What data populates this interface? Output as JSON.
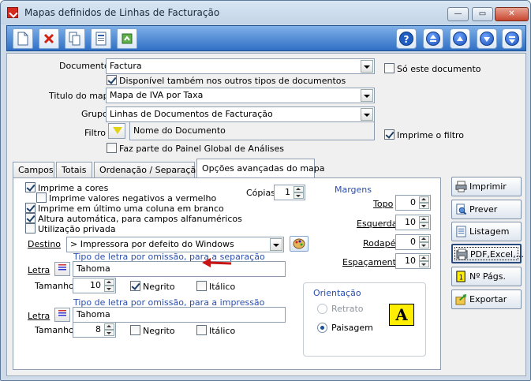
{
  "window": {
    "title": "Mapas definidos de Linhas de Facturação",
    "controls": {
      "minimize": "—",
      "maximize": "▭",
      "close": "✕"
    }
  },
  "toolbar": {
    "buttons": [
      {
        "name": "new",
        "icon": "new-document-icon"
      },
      {
        "name": "delete",
        "icon": "delete-x-icon"
      },
      {
        "name": "copy",
        "icon": "copy-icon"
      },
      {
        "name": "properties",
        "icon": "properties-icon"
      },
      {
        "name": "refresh",
        "icon": "refresh-icon"
      }
    ],
    "nav_buttons": [
      {
        "name": "help",
        "icon": "help-icon",
        "glyph": "?"
      },
      {
        "name": "first",
        "icon": "first-record-icon"
      },
      {
        "name": "previous",
        "icon": "previous-record-icon"
      },
      {
        "name": "next",
        "icon": "next-record-icon"
      },
      {
        "name": "last",
        "icon": "last-record-icon"
      }
    ]
  },
  "form": {
    "documento_label": "Documento",
    "documento_value": "Factura",
    "so_este_documento": "Só este documento",
    "disponivel_outros": "Disponível também nos outros tipos de documentos",
    "titulo_label": "Titulo do mapa",
    "titulo_value": "Mapa de IVA por Taxa",
    "grupo_label": "Grupo",
    "grupo_value": "Linhas de Documentos de Facturação",
    "filtro_label": "Filtro",
    "filtro_value": "Nome do Documento",
    "imprime_filtro": "Imprime o filtro",
    "painel_global": "Faz parte do Painel Global de Análises"
  },
  "tabs": [
    {
      "label": "Campos",
      "active": false
    },
    {
      "label": "Totais",
      "active": false
    },
    {
      "label": "Ordenação / Separação",
      "active": false
    },
    {
      "label": "Opções avançadas do mapa",
      "active": true
    }
  ],
  "advanced": {
    "imprime_cores": "Imprime a cores",
    "valores_negativos": "Imprime valores negativos a vermelho",
    "ultimo_branco": "Imprime em último uma coluna em branco",
    "altura_automatica": "Altura automática, para campos alfanuméricos",
    "utilizacao_privada": "Utilização privada",
    "copias_label": "Cópias",
    "copias_value": "1",
    "destino_label": "Destino",
    "destino_value": "> Impressora por defeito do Windows",
    "sep_font_title": "Tipo de letra por omissão, para a separação",
    "imp_font_title": "Tipo de letra por omissão, para a impressão",
    "letra_label": "Letra",
    "tamanho_label": "Tamanho",
    "sep_font": "Tahoma",
    "sep_size": "10",
    "imp_font": "Tahoma",
    "imp_size": "8",
    "negrito": "Negrito",
    "italico": "Itálico",
    "margens_title": "Margens",
    "topo_label": "Topo",
    "topo_value": "0",
    "esquerda_label": "Esquerda",
    "esquerda_value": "10",
    "rodape_label": "Rodapé",
    "rodape_value": "0",
    "espacamento_label": "Espaçamento",
    "espacamento_value": "10",
    "orientacao_title": "Orientação",
    "retrato": "Retrato",
    "paisagem": "Paisagem",
    "orientation_glyph": "A"
  },
  "side_buttons": {
    "imprimir": "Imprimir",
    "prever": "Prever",
    "listagem": "Listagem",
    "pdf": "PDF,Excel,...",
    "n_pags": "Nº Págs.",
    "exportar": "Exportar"
  },
  "colors": {
    "accent_blue": "#2a4fb0",
    "toolbar_blue": "#2f6fc5",
    "arrow_red": "#c81414"
  }
}
